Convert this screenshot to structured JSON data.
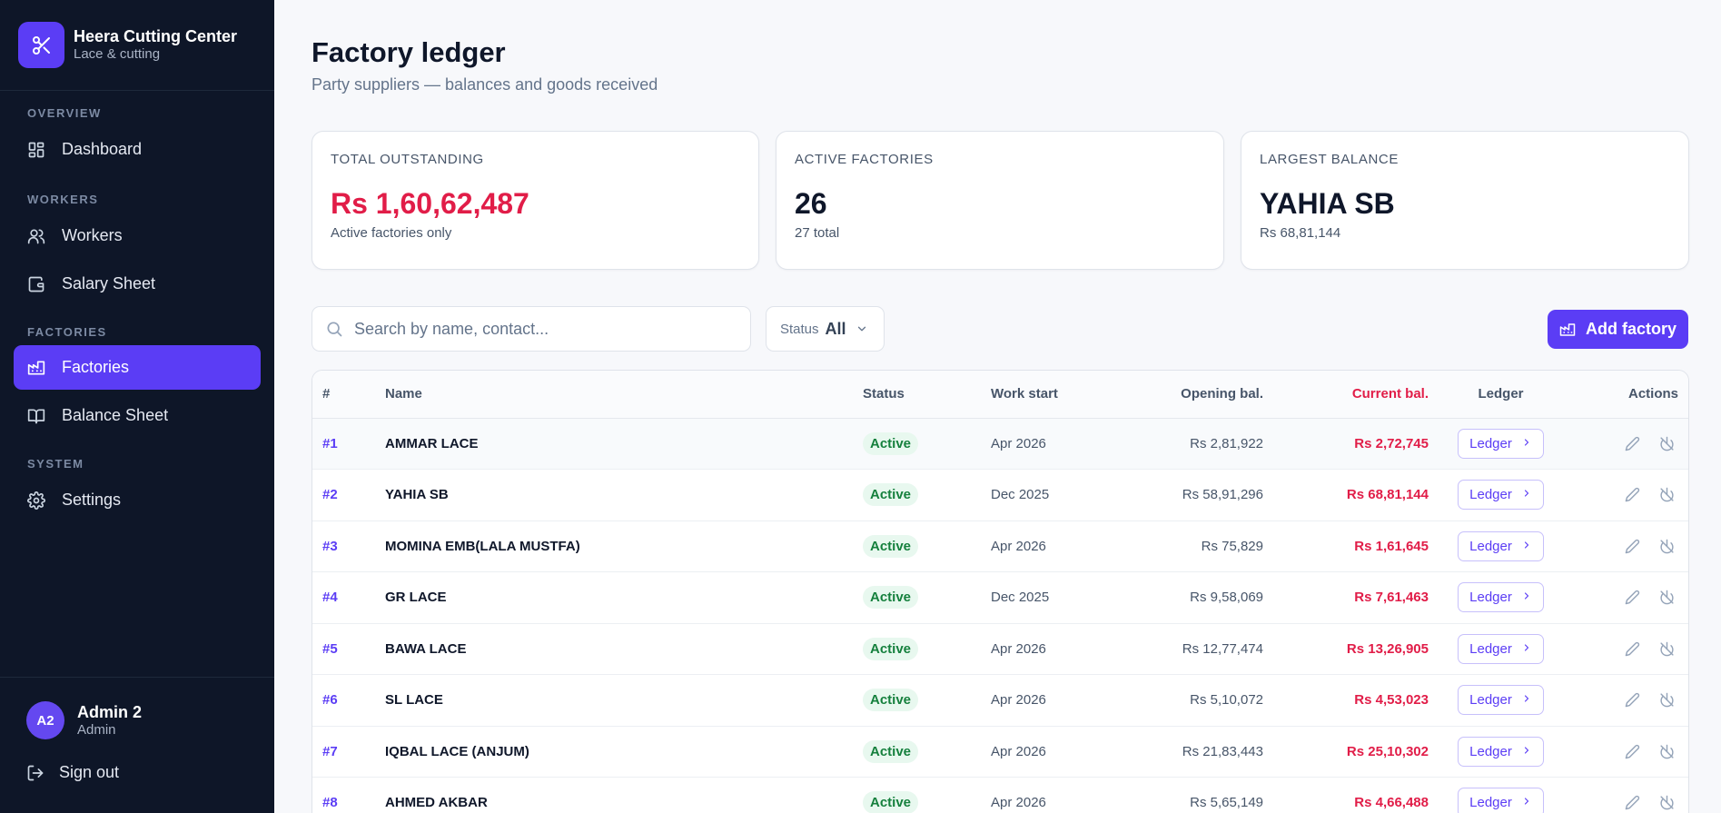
{
  "brand": {
    "name": "Heera Cutting Center",
    "tagline": "Lace & cutting"
  },
  "nav": {
    "sections": [
      {
        "title": "OVERVIEW",
        "items": [
          {
            "label": "Dashboard",
            "icon": "dashboard-icon"
          }
        ]
      },
      {
        "title": "WORKERS",
        "items": [
          {
            "label": "Workers",
            "icon": "users-icon"
          },
          {
            "label": "Salary Sheet",
            "icon": "wallet-icon"
          }
        ]
      },
      {
        "title": "FACTORIES",
        "items": [
          {
            "label": "Factories",
            "icon": "factory-icon",
            "active": true
          },
          {
            "label": "Balance Sheet",
            "icon": "book-icon"
          }
        ]
      },
      {
        "title": "SYSTEM",
        "items": [
          {
            "label": "Settings",
            "icon": "gear-icon"
          }
        ]
      }
    ]
  },
  "user": {
    "initials": "A2",
    "name": "Admin 2",
    "role": "Admin"
  },
  "signout_label": "Sign out",
  "page": {
    "title": "Factory ledger",
    "subtitle": "Party suppliers — balances and goods received"
  },
  "cards": [
    {
      "label": "TOTAL OUTSTANDING",
      "value": "Rs 1,60,62,487",
      "note": "Active factories only",
      "value_color": "#e11d48"
    },
    {
      "label": "ACTIVE FACTORIES",
      "value": "26",
      "note": "27 total",
      "value_color": "#0f172a"
    },
    {
      "label": "LARGEST BALANCE",
      "value": "YAHIA SB",
      "note": "Rs 68,81,144",
      "value_color": "#0f172a"
    }
  ],
  "search": {
    "placeholder": "Search by name, contact..."
  },
  "status_filter": {
    "label": "Status",
    "value": "All"
  },
  "add_button": "Add factory",
  "table": {
    "columns": {
      "num": "#",
      "name": "Name",
      "status": "Status",
      "work_start": "Work start",
      "opening": "Opening bal.",
      "current": "Current bal.",
      "ledger": "Ledger",
      "actions": "Actions"
    },
    "ledger_label": "Ledger",
    "rows": [
      {
        "num": "#1",
        "name": "AMMAR LACE",
        "status": "Active",
        "work_start": "Apr 2026",
        "opening": "Rs 2,81,922",
        "current": "Rs 2,72,745"
      },
      {
        "num": "#2",
        "name": "YAHIA SB",
        "status": "Active",
        "work_start": "Dec 2025",
        "opening": "Rs 58,91,296",
        "current": "Rs 68,81,144"
      },
      {
        "num": "#3",
        "name": "MOMINA EMB(LALA MUSTFA)",
        "status": "Active",
        "work_start": "Apr 2026",
        "opening": "Rs 75,829",
        "current": "Rs 1,61,645"
      },
      {
        "num": "#4",
        "name": "GR LACE",
        "status": "Active",
        "work_start": "Dec 2025",
        "opening": "Rs 9,58,069",
        "current": "Rs 7,61,463"
      },
      {
        "num": "#5",
        "name": "BAWA LACE",
        "status": "Active",
        "work_start": "Apr 2026",
        "opening": "Rs 12,77,474",
        "current": "Rs 13,26,905"
      },
      {
        "num": "#6",
        "name": "SL LACE",
        "status": "Active",
        "work_start": "Apr 2026",
        "opening": "Rs 5,10,072",
        "current": "Rs 4,53,023"
      },
      {
        "num": "#7",
        "name": "IQBAL LACE (ANJUM)",
        "status": "Active",
        "work_start": "Apr 2026",
        "opening": "Rs 21,83,443",
        "current": "Rs 25,10,302"
      },
      {
        "num": "#8",
        "name": "AHMED AKBAR",
        "status": "Active",
        "work_start": "Apr 2026",
        "opening": "Rs 5,65,149",
        "current": "Rs 4,66,488"
      }
    ]
  }
}
